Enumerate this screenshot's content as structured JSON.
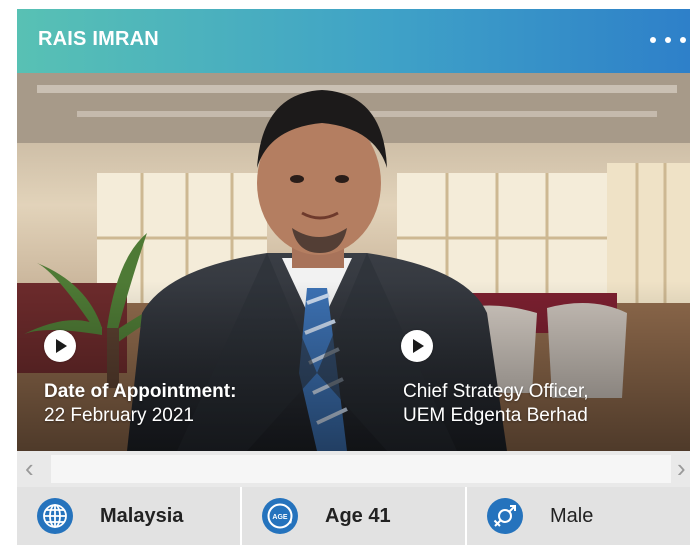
{
  "profile": {
    "name": "RAIS IMRAN",
    "appointment_label": "Date of Appointment:",
    "appointment_date": "22 February 2021",
    "position_line1": "Chief Strategy Officer,",
    "position_line2": "UEM Edgenta Berhad"
  },
  "stats": {
    "country": "Malaysia",
    "age": "Age 41",
    "age_icon_text": "AGE",
    "gender": "Male"
  },
  "icons": {
    "more": "more-dots-icon",
    "play": "play-icon",
    "country": "globe-icon",
    "age": "age-icon",
    "gender": "gender-icon",
    "scroll_left": "chevron-left-icon",
    "scroll_right": "chevron-right-icon"
  },
  "colors": {
    "header_gradient_start": "#58c1b4",
    "header_gradient_end": "#2e80c9",
    "icon_blue": "#2573bd",
    "stat_bar": "#e2e2e2"
  }
}
